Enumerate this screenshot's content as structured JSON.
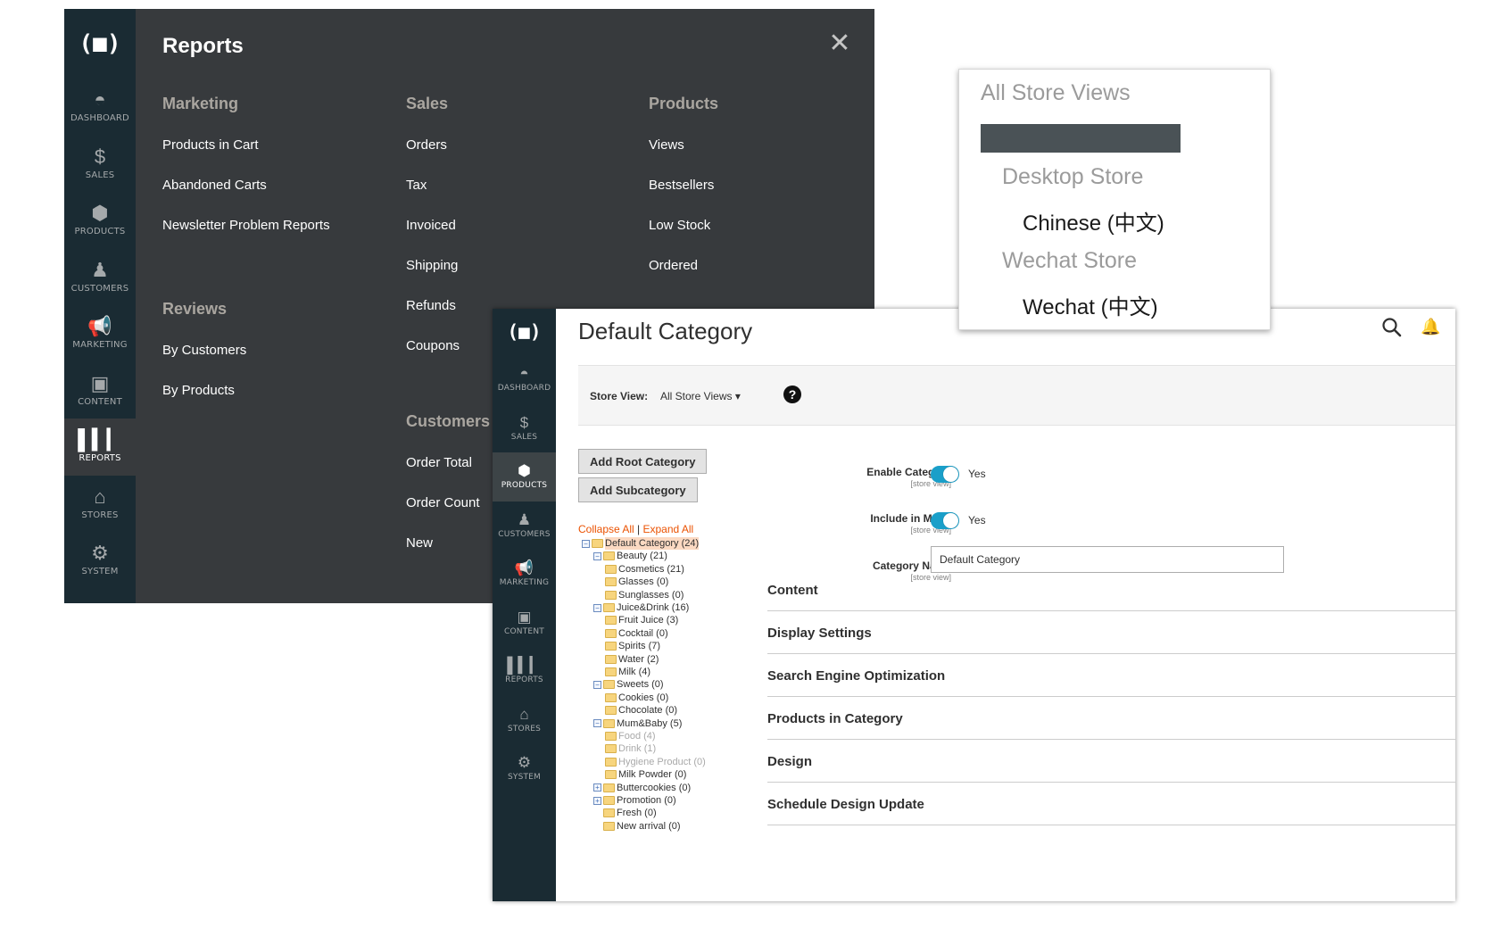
{
  "reports_panel": {
    "logo": "(■)",
    "nav": [
      {
        "icon": "dashboard-icon",
        "glyph": "◓",
        "label": "DASHBOARD"
      },
      {
        "icon": "dollar-icon",
        "glyph": "$",
        "label": "SALES"
      },
      {
        "icon": "box-icon",
        "glyph": "⬢",
        "label": "PRODUCTS"
      },
      {
        "icon": "person-icon",
        "glyph": "♟",
        "label": "CUSTOMERS"
      },
      {
        "icon": "megaphone-icon",
        "glyph": "📢",
        "label": "MARKETING"
      },
      {
        "icon": "content-icon",
        "glyph": "▣",
        "label": "CONTENT"
      },
      {
        "icon": "bar-chart-icon",
        "glyph": "▌▍▎",
        "label": "REPORTS"
      },
      {
        "icon": "store-icon",
        "glyph": "⌂",
        "label": "STORES"
      },
      {
        "icon": "gear-icon",
        "glyph": "⚙",
        "label": "SYSTEM"
      }
    ],
    "title": "Reports",
    "close_glyph": "✕",
    "marketing": {
      "heading": "Marketing",
      "links": [
        "Products in Cart",
        "Abandoned Carts",
        "Newsletter Problem Reports"
      ]
    },
    "reviews": {
      "heading": "Reviews",
      "links": [
        "By Customers",
        "By Products"
      ]
    },
    "sales": {
      "heading": "Sales",
      "links": [
        "Orders",
        "Tax",
        "Invoiced",
        "Shipping",
        "Refunds",
        "Coupons"
      ]
    },
    "customers": {
      "heading": "Customers",
      "links": [
        "Order Total",
        "Order Count",
        "New"
      ]
    },
    "products": {
      "heading": "Products",
      "links": [
        "Views",
        "Bestsellers",
        "Low Stock",
        "Ordered"
      ]
    }
  },
  "store_dropdown": {
    "all": "All Store Views",
    "groups": [
      {
        "name": "Desktop Store",
        "view": "Chinese (中文)"
      },
      {
        "name": "Wechat Store",
        "view": "Wechat (中文)"
      }
    ]
  },
  "category_page": {
    "logo": "(■)",
    "nav": [
      {
        "icon": "dashboard-icon",
        "glyph": "◓",
        "label": "DASHBOARD"
      },
      {
        "icon": "dollar-icon",
        "glyph": "$",
        "label": "SALES"
      },
      {
        "icon": "box-icon",
        "glyph": "⬢",
        "label": "PRODUCTS"
      },
      {
        "icon": "person-icon",
        "glyph": "♟",
        "label": "CUSTOMERS"
      },
      {
        "icon": "megaphone-icon",
        "glyph": "📢",
        "label": "MARKETING"
      },
      {
        "icon": "content-icon",
        "glyph": "▣",
        "label": "CONTENT"
      },
      {
        "icon": "bar-chart-icon",
        "glyph": "▌▍▎",
        "label": "REPORTS"
      },
      {
        "icon": "store-icon",
        "glyph": "⌂",
        "label": "STORES"
      },
      {
        "icon": "gear-icon",
        "glyph": "⚙",
        "label": "SYSTEM"
      }
    ],
    "title": "Default Category",
    "bell_glyph": "🔔",
    "store_view_label": "Store View:",
    "store_view_value": "All Store Views ▾",
    "help_glyph": "?",
    "buttons": {
      "add_root": "Add Root Category",
      "add_sub": "Add Subcategory"
    },
    "tree_controls": {
      "collapse": "Collapse All",
      "sep": " | ",
      "expand": "Expand All"
    },
    "tree": [
      {
        "label": "Default Category (24)",
        "level": 0,
        "toggle": "−",
        "selected": true
      },
      {
        "label": "Beauty (21)",
        "level": 1,
        "toggle": "−"
      },
      {
        "label": "Cosmetics (21)",
        "level": 2
      },
      {
        "label": "Glasses (0)",
        "level": 2
      },
      {
        "label": "Sunglasses (0)",
        "level": 2
      },
      {
        "label": "Juice&Drink (16)",
        "level": 1,
        "toggle": "−"
      },
      {
        "label": "Fruit Juice (3)",
        "level": 2
      },
      {
        "label": "Cocktail (0)",
        "level": 2
      },
      {
        "label": "Spirits (7)",
        "level": 2
      },
      {
        "label": "Water (2)",
        "level": 2
      },
      {
        "label": "Milk (4)",
        "level": 2
      },
      {
        "label": "Sweets (0)",
        "level": 1,
        "toggle": "−"
      },
      {
        "label": "Cookies (0)",
        "level": 2
      },
      {
        "label": "Chocolate (0)",
        "level": 2
      },
      {
        "label": "Mum&Baby (5)",
        "level": 1,
        "toggle": "−"
      },
      {
        "label": "Food (4)",
        "level": 2,
        "disabled": true
      },
      {
        "label": "Drink (1)",
        "level": 2,
        "disabled": true
      },
      {
        "label": "Hygiene Product (0)",
        "level": 2,
        "disabled": true
      },
      {
        "label": "Milk Powder (0)",
        "level": 2
      },
      {
        "label": "Buttercookies (0)",
        "level": 1,
        "toggle": "+"
      },
      {
        "label": "Promotion (0)",
        "level": 1,
        "toggle": "+"
      },
      {
        "label": "Fresh (0)",
        "level": 1
      },
      {
        "label": "New arrival (0)",
        "level": 1
      }
    ],
    "fields": {
      "enable_label": "Enable Category",
      "enable_scope": "[store view]",
      "enable_value": "Yes",
      "menu_label": "Include in Menu",
      "menu_scope": "[store view]",
      "menu_value": "Yes",
      "name_label": "Category Name",
      "name_scope": "[store view]",
      "name_value": "Default Category",
      "required_star": "*"
    },
    "sections": [
      "Content",
      "Display Settings",
      "Search Engine Optimization",
      "Products in Category",
      "Design",
      "Schedule Design Update"
    ]
  }
}
